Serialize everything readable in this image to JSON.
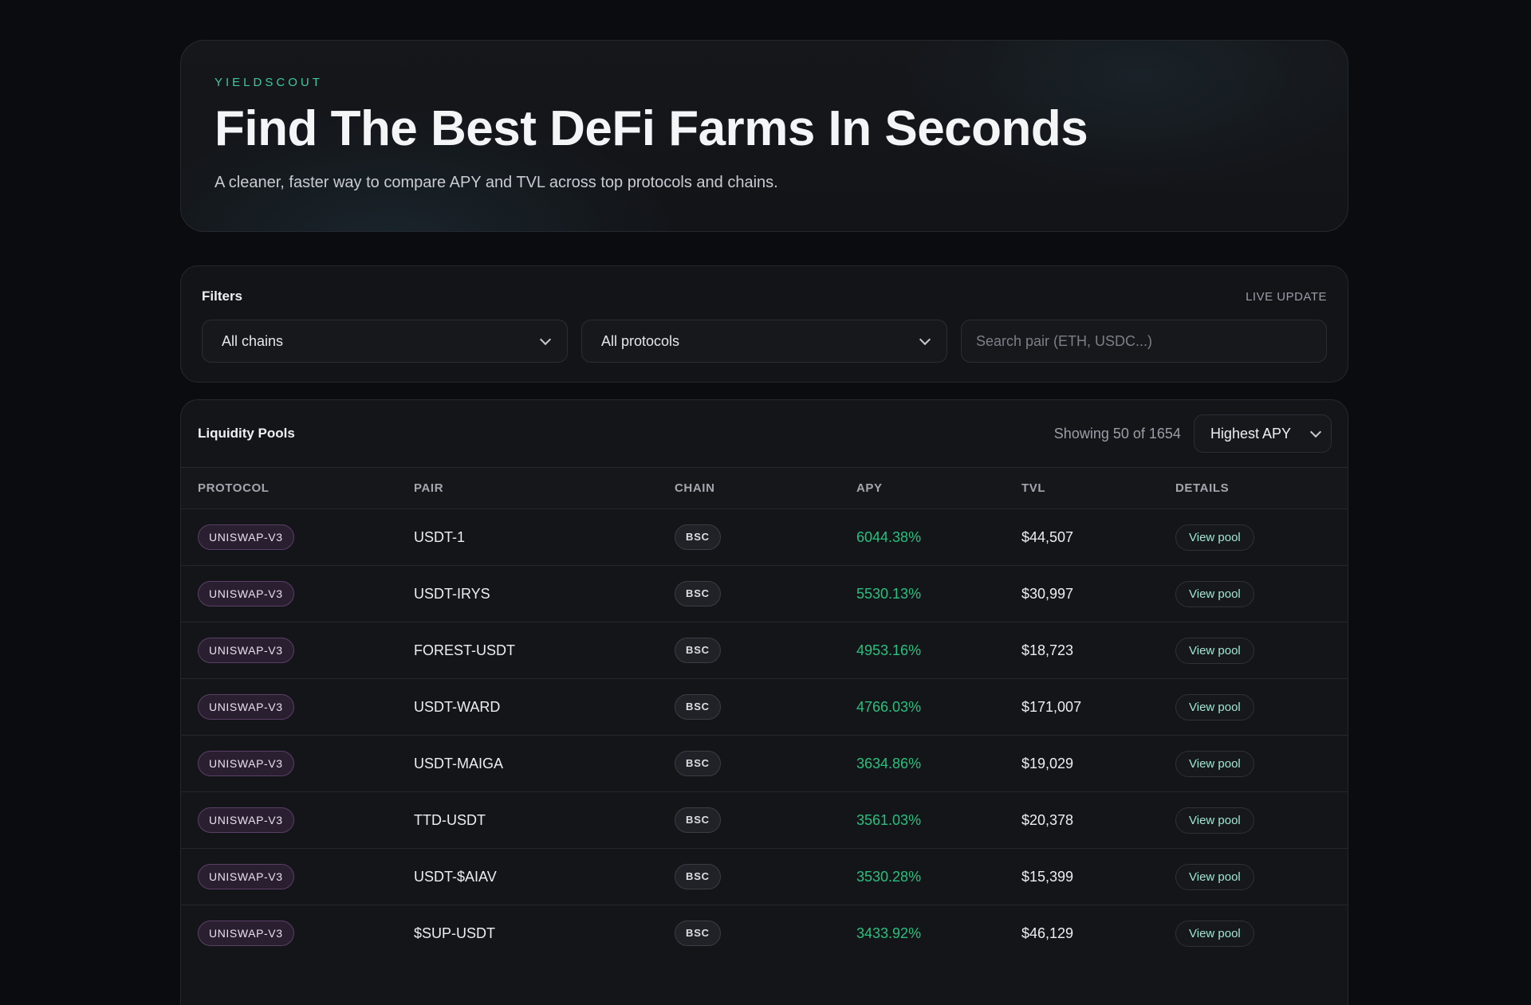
{
  "hero": {
    "brand": "YIELDSCOUT",
    "title": "Find The Best DeFi Farms In Seconds",
    "subtitle": "A cleaner, faster way to compare APY and TVL across top protocols and chains."
  },
  "filters": {
    "title": "Filters",
    "live_label": "LIVE UPDATE",
    "chain_select": "All chains",
    "protocol_select": "All protocols",
    "search_placeholder": "Search pair (ETH, USDC...)"
  },
  "pools": {
    "title": "Liquidity Pools",
    "showing": "Showing 50 of 1654",
    "sort": "Highest APY",
    "columns": [
      "PROTOCOL",
      "PAIR",
      "CHAIN",
      "APY",
      "TVL",
      "DETAILS"
    ],
    "rows": [
      {
        "protocol": "UNISWAP-V3",
        "pair": "USDT-1",
        "chain": "BSC",
        "apy": "6044.38%",
        "tvl": "$44,507",
        "action": "View pool"
      },
      {
        "protocol": "UNISWAP-V3",
        "pair": "USDT-IRYS",
        "chain": "BSC",
        "apy": "5530.13%",
        "tvl": "$30,997",
        "action": "View pool"
      },
      {
        "protocol": "UNISWAP-V3",
        "pair": "FOREST-USDT",
        "chain": "BSC",
        "apy": "4953.16%",
        "tvl": "$18,723",
        "action": "View pool"
      },
      {
        "protocol": "UNISWAP-V3",
        "pair": "USDT-WARD",
        "chain": "BSC",
        "apy": "4766.03%",
        "tvl": "$171,007",
        "action": "View pool"
      },
      {
        "protocol": "UNISWAP-V3",
        "pair": "USDT-MAIGA",
        "chain": "BSC",
        "apy": "3634.86%",
        "tvl": "$19,029",
        "action": "View pool"
      },
      {
        "protocol": "UNISWAP-V3",
        "pair": "TTD-USDT",
        "chain": "BSC",
        "apy": "3561.03%",
        "tvl": "$20,378",
        "action": "View pool"
      },
      {
        "protocol": "UNISWAP-V3",
        "pair": "USDT-$AIAV",
        "chain": "BSC",
        "apy": "3530.28%",
        "tvl": "$15,399",
        "action": "View pool"
      },
      {
        "protocol": "UNISWAP-V3",
        "pair": "$SUP-USDT",
        "chain": "BSC",
        "apy": "3433.92%",
        "tvl": "$46,129",
        "action": "View pool"
      }
    ]
  }
}
